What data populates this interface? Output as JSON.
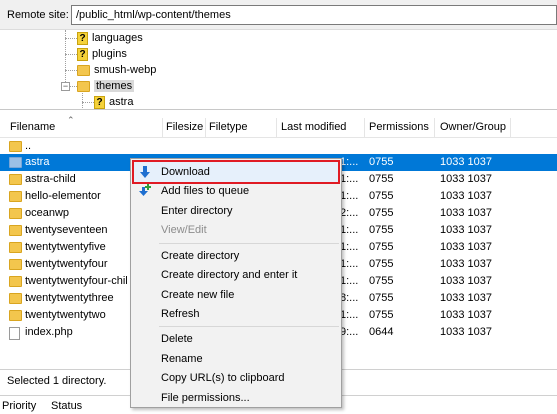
{
  "site": {
    "label": "Remote site:",
    "path": "/public_html/wp-content/themes"
  },
  "tree": {
    "items": [
      {
        "label": "languages",
        "icon": "unknown-folder-icon"
      },
      {
        "label": "plugins",
        "icon": "unknown-folder-icon"
      },
      {
        "label": "smush-webp",
        "icon": "folder-icon"
      },
      {
        "label": "themes",
        "icon": "folder-icon"
      },
      {
        "label": "astra",
        "icon": "unknown-folder-icon"
      }
    ]
  },
  "columns": {
    "filename": "Filename",
    "filesize": "Filesize",
    "filetype": "Filetype",
    "modified": "Last modified",
    "permissions": "Permissions",
    "owner": "Owner/Group"
  },
  "files": [
    {
      "name": "..",
      "mod": "",
      "perm": "",
      "owner": ""
    },
    {
      "name": "astra",
      "mod": "1:...",
      "perm": "0755",
      "owner": "1033 1037"
    },
    {
      "name": "astra-child",
      "mod": "1:...",
      "perm": "0755",
      "owner": "1033 1037"
    },
    {
      "name": "hello-elementor",
      "mod": "1:...",
      "perm": "0755",
      "owner": "1033 1037"
    },
    {
      "name": "oceanwp",
      "mod": "2:...",
      "perm": "0755",
      "owner": "1033 1037"
    },
    {
      "name": "twentyseventeen",
      "mod": "1:...",
      "perm": "0755",
      "owner": "1033 1037"
    },
    {
      "name": "twentytwentyfive",
      "mod": "1:...",
      "perm": "0755",
      "owner": "1033 1037"
    },
    {
      "name": "twentytwentyfour",
      "mod": "1:...",
      "perm": "0755",
      "owner": "1033 1037"
    },
    {
      "name": "twentytwentyfour-chil",
      "mod": "1:...",
      "perm": "0755",
      "owner": "1033 1037"
    },
    {
      "name": "twentytwentythree",
      "mod": "8:...",
      "perm": "0755",
      "owner": "1033 1037"
    },
    {
      "name": "twentytwentytwo",
      "mod": "1:...",
      "perm": "0755",
      "owner": "1033 1037"
    },
    {
      "name": "index.php",
      "mod": "9:...",
      "perm": "0644",
      "owner": "1033 1037"
    }
  ],
  "status": {
    "text": "Selected 1 directory."
  },
  "queue": {
    "priority": "Priority",
    "status": "Status"
  },
  "context_menu": {
    "download": "Download",
    "add_to_queue": "Add files to queue",
    "enter_directory": "Enter directory",
    "view_edit": "View/Edit",
    "create_directory": "Create directory",
    "create_directory_enter": "Create directory and enter it",
    "create_file": "Create new file",
    "refresh": "Refresh",
    "delete": "Delete",
    "rename": "Rename",
    "copy_url": "Copy URL(s) to clipboard",
    "file_permissions": "File permissions..."
  },
  "colors": {
    "selection": "#0078d7",
    "highlight_border": "#e01b24",
    "folder": "#f3c64d"
  }
}
